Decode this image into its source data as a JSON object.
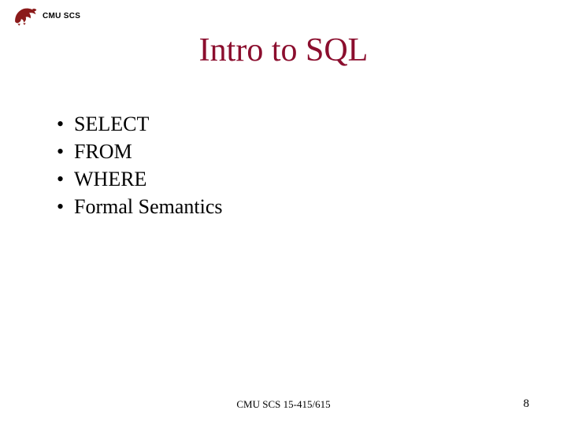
{
  "header": {
    "org_label": "CMU SCS"
  },
  "title": "Intro to SQL",
  "bullets": {
    "items": [
      {
        "text": "SELECT"
      },
      {
        "text": "FROM"
      },
      {
        "text": "WHERE"
      },
      {
        "text": "Formal Semantics"
      }
    ]
  },
  "footer": {
    "center": "CMU SCS 15-415/615",
    "page": "8"
  },
  "colors": {
    "title": "#8b0e2e",
    "logo": "#8b1a1a"
  }
}
